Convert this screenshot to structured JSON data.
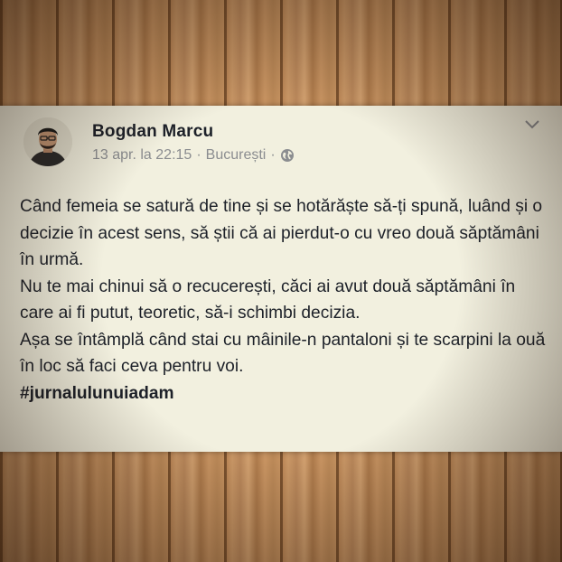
{
  "post": {
    "author": "Bogdan Marcu",
    "date": "13 apr. la 22:15",
    "location": "București",
    "separator": "·",
    "privacy_icon": "globe-icon",
    "menu_icon": "chevron-down-icon",
    "paragraphs": [
      "Când femeia se satură de tine și se hotărăște să-ți spună, luând și o decizie în acest sens, să știi că ai pierdut-o cu vreo două săptămâni în urmă.",
      "Nu te mai chinui să o recucerești, căci ai avut două săptămâni în care ai fi putut, teoretic, să-i schimbi decizia.",
      "Așa se întâmplă când stai cu mâinile-n pantaloni și te scarpini la ouă în loc să faci ceva pentru voi."
    ],
    "hashtag": "#jurnalulunuiadam"
  },
  "colors": {
    "card_background": "#f2f0df",
    "text": "#1d2129",
    "meta_text": "#8b8d90",
    "wood": "#c4915f"
  }
}
